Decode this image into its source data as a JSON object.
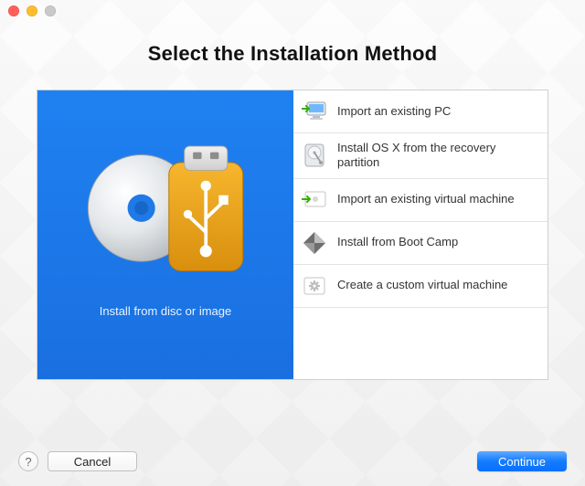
{
  "header": {
    "title": "Select the Installation Method"
  },
  "main_option": {
    "icon": "disc-usb-icon",
    "label": "Install from disc or image"
  },
  "options": [
    {
      "icon": "import-pc-icon",
      "label": "Import an existing PC"
    },
    {
      "icon": "hdd-icon",
      "label": "Install OS X from the recovery partition"
    },
    {
      "icon": "import-vm-icon",
      "label": "Import an existing virtual machine"
    },
    {
      "icon": "bootcamp-icon",
      "label": "Install from Boot Camp"
    },
    {
      "icon": "custom-vm-icon",
      "label": "Create a custom virtual machine"
    }
  ],
  "footer": {
    "help": "?",
    "cancel_label": "Cancel",
    "continue_label": "Continue"
  }
}
